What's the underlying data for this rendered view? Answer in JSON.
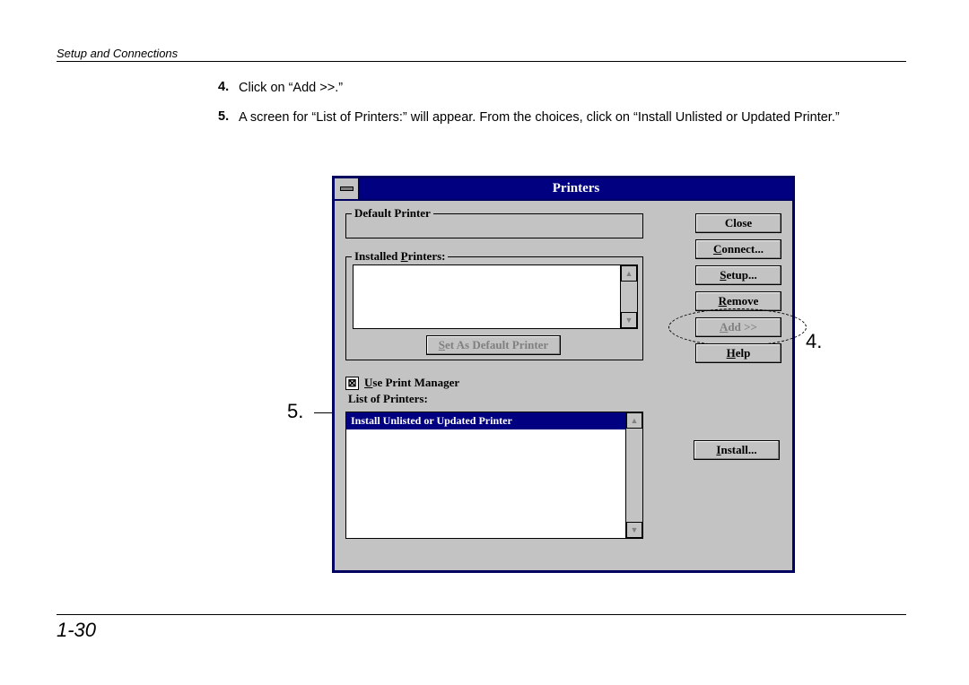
{
  "header": {
    "run": "Setup and Connections"
  },
  "steps": {
    "n4": "4.",
    "t4": "Click on “Add >>.”",
    "n5": "5.",
    "t5": "A screen for “List of Printers:” will appear.  From the choices, click on “Install Unlisted or Updated Printer.”"
  },
  "window": {
    "title": "Printers",
    "groups": {
      "default_printer": "Default Printer",
      "installed_printers_pre": "Installed ",
      "installed_printers_u": "P",
      "installed_printers_post": "rinters:",
      "list_of_printers": "List of Printers:"
    },
    "buttons": {
      "close": "Close",
      "connect_u": "C",
      "connect_post": "onnect...",
      "setup_u": "S",
      "setup_post": "etup...",
      "remove_u": "R",
      "remove_post": "emove",
      "add_u": "A",
      "add_post": "dd >>",
      "help_u": "H",
      "help_post": "elp",
      "set_default_u": "S",
      "set_default_post": "et As Default Printer",
      "install_u": "I",
      "install_post": "nstall..."
    },
    "checkbox": {
      "mark": "☒",
      "pre": "",
      "u": "U",
      "post": "se Print Manager"
    },
    "list_selected": "Install Unlisted or Updated Printer"
  },
  "callouts": {
    "c4": "4.",
    "c5": "5."
  },
  "footer": {
    "page": "1-30"
  }
}
